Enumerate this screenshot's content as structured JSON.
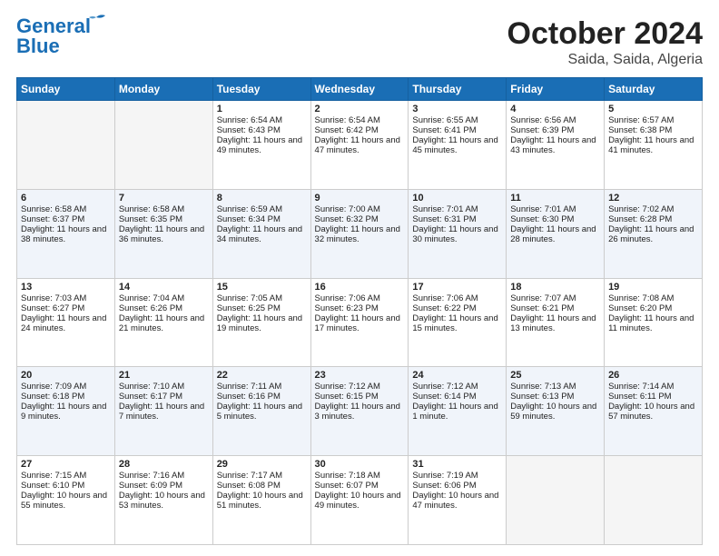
{
  "header": {
    "logo_line1": "General",
    "logo_line2": "Blue",
    "title": "October 2024",
    "subtitle": "Saida, Saida, Algeria"
  },
  "days_of_week": [
    "Sunday",
    "Monday",
    "Tuesday",
    "Wednesday",
    "Thursday",
    "Friday",
    "Saturday"
  ],
  "weeks": [
    [
      {
        "day": "",
        "empty": true
      },
      {
        "day": "",
        "empty": true
      },
      {
        "day": "1",
        "sunrise": "6:54 AM",
        "sunset": "6:43 PM",
        "daylight": "11 hours and 49 minutes."
      },
      {
        "day": "2",
        "sunrise": "6:54 AM",
        "sunset": "6:42 PM",
        "daylight": "11 hours and 47 minutes."
      },
      {
        "day": "3",
        "sunrise": "6:55 AM",
        "sunset": "6:41 PM",
        "daylight": "11 hours and 45 minutes."
      },
      {
        "day": "4",
        "sunrise": "6:56 AM",
        "sunset": "6:39 PM",
        "daylight": "11 hours and 43 minutes."
      },
      {
        "day": "5",
        "sunrise": "6:57 AM",
        "sunset": "6:38 PM",
        "daylight": "11 hours and 41 minutes."
      }
    ],
    [
      {
        "day": "6",
        "sunrise": "6:58 AM",
        "sunset": "6:37 PM",
        "daylight": "11 hours and 38 minutes."
      },
      {
        "day": "7",
        "sunrise": "6:58 AM",
        "sunset": "6:35 PM",
        "daylight": "11 hours and 36 minutes."
      },
      {
        "day": "8",
        "sunrise": "6:59 AM",
        "sunset": "6:34 PM",
        "daylight": "11 hours and 34 minutes."
      },
      {
        "day": "9",
        "sunrise": "7:00 AM",
        "sunset": "6:32 PM",
        "daylight": "11 hours and 32 minutes."
      },
      {
        "day": "10",
        "sunrise": "7:01 AM",
        "sunset": "6:31 PM",
        "daylight": "11 hours and 30 minutes."
      },
      {
        "day": "11",
        "sunrise": "7:01 AM",
        "sunset": "6:30 PM",
        "daylight": "11 hours and 28 minutes."
      },
      {
        "day": "12",
        "sunrise": "7:02 AM",
        "sunset": "6:28 PM",
        "daylight": "11 hours and 26 minutes."
      }
    ],
    [
      {
        "day": "13",
        "sunrise": "7:03 AM",
        "sunset": "6:27 PM",
        "daylight": "11 hours and 24 minutes."
      },
      {
        "day": "14",
        "sunrise": "7:04 AM",
        "sunset": "6:26 PM",
        "daylight": "11 hours and 21 minutes."
      },
      {
        "day": "15",
        "sunrise": "7:05 AM",
        "sunset": "6:25 PM",
        "daylight": "11 hours and 19 minutes."
      },
      {
        "day": "16",
        "sunrise": "7:06 AM",
        "sunset": "6:23 PM",
        "daylight": "11 hours and 17 minutes."
      },
      {
        "day": "17",
        "sunrise": "7:06 AM",
        "sunset": "6:22 PM",
        "daylight": "11 hours and 15 minutes."
      },
      {
        "day": "18",
        "sunrise": "7:07 AM",
        "sunset": "6:21 PM",
        "daylight": "11 hours and 13 minutes."
      },
      {
        "day": "19",
        "sunrise": "7:08 AM",
        "sunset": "6:20 PM",
        "daylight": "11 hours and 11 minutes."
      }
    ],
    [
      {
        "day": "20",
        "sunrise": "7:09 AM",
        "sunset": "6:18 PM",
        "daylight": "11 hours and 9 minutes."
      },
      {
        "day": "21",
        "sunrise": "7:10 AM",
        "sunset": "6:17 PM",
        "daylight": "11 hours and 7 minutes."
      },
      {
        "day": "22",
        "sunrise": "7:11 AM",
        "sunset": "6:16 PM",
        "daylight": "11 hours and 5 minutes."
      },
      {
        "day": "23",
        "sunrise": "7:12 AM",
        "sunset": "6:15 PM",
        "daylight": "11 hours and 3 minutes."
      },
      {
        "day": "24",
        "sunrise": "7:12 AM",
        "sunset": "6:14 PM",
        "daylight": "11 hours and 1 minute."
      },
      {
        "day": "25",
        "sunrise": "7:13 AM",
        "sunset": "6:13 PM",
        "daylight": "10 hours and 59 minutes."
      },
      {
        "day": "26",
        "sunrise": "7:14 AM",
        "sunset": "6:11 PM",
        "daylight": "10 hours and 57 minutes."
      }
    ],
    [
      {
        "day": "27",
        "sunrise": "7:15 AM",
        "sunset": "6:10 PM",
        "daylight": "10 hours and 55 minutes."
      },
      {
        "day": "28",
        "sunrise": "7:16 AM",
        "sunset": "6:09 PM",
        "daylight": "10 hours and 53 minutes."
      },
      {
        "day": "29",
        "sunrise": "7:17 AM",
        "sunset": "6:08 PM",
        "daylight": "10 hours and 51 minutes."
      },
      {
        "day": "30",
        "sunrise": "7:18 AM",
        "sunset": "6:07 PM",
        "daylight": "10 hours and 49 minutes."
      },
      {
        "day": "31",
        "sunrise": "7:19 AM",
        "sunset": "6:06 PM",
        "daylight": "10 hours and 47 minutes."
      },
      {
        "day": "",
        "empty": true
      },
      {
        "day": "",
        "empty": true
      }
    ]
  ]
}
